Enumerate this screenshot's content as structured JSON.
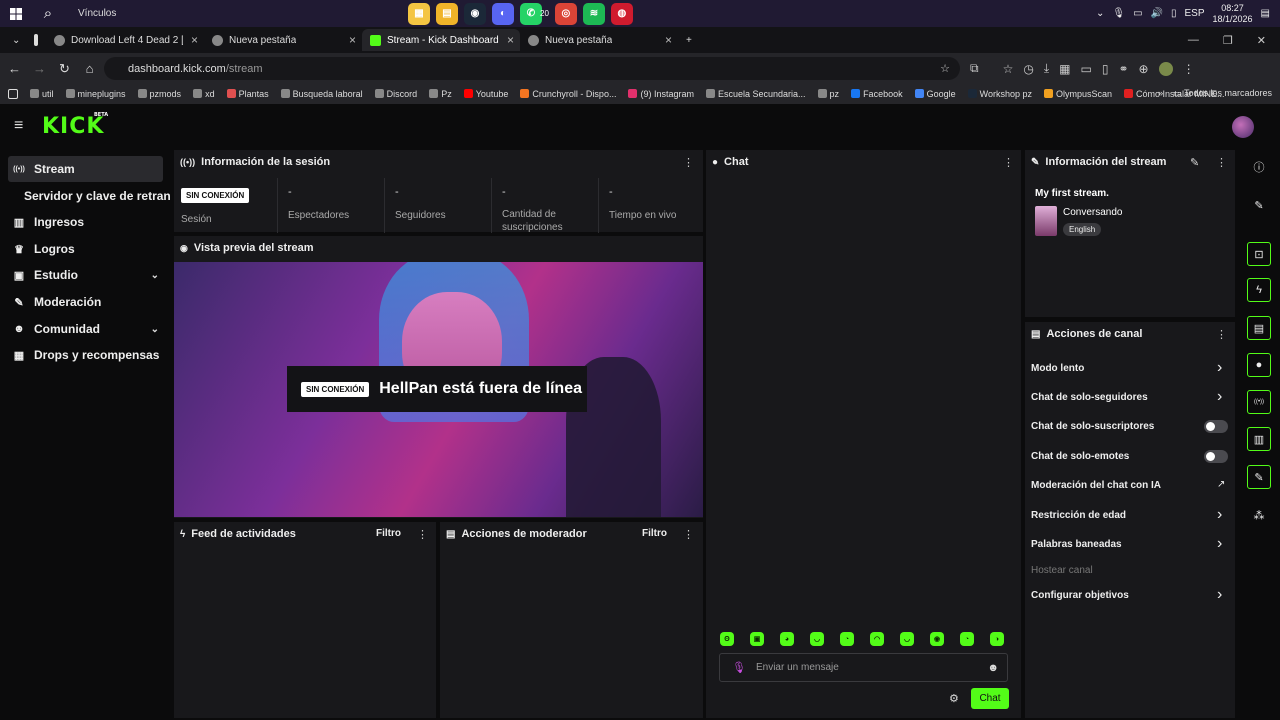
{
  "taskbar": {
    "vinculos": "Vínculos",
    "apps": [
      {
        "name": "files-app",
        "glyph": "▦",
        "color": "#f4c542"
      },
      {
        "name": "explorer-app",
        "glyph": "▤",
        "color": "#f0b429"
      },
      {
        "name": "steam-app",
        "glyph": "◉",
        "color": "#1b2838"
      },
      {
        "name": "discord-app",
        "glyph": "◐",
        "color": "#5865f2"
      },
      {
        "name": "whatsapp-app",
        "glyph": "✆",
        "color": "#25d366"
      },
      {
        "name": "chrome-app",
        "glyph": "◎",
        "color": "#db4437"
      },
      {
        "name": "spotify-app",
        "glyph": "≋",
        "color": "#1db954"
      },
      {
        "name": "opera-app",
        "glyph": "◍",
        "color": "#d01b2e"
      }
    ],
    "whatsapp_badge": "20",
    "lang": "ESP",
    "time": "08:27",
    "date": "18/1/2026"
  },
  "browser": {
    "tabs": [
      {
        "title": "Download Left 4 Dead 2 [PC] [",
        "active": false
      },
      {
        "title": "Nueva pestaña",
        "active": false
      },
      {
        "title": "Stream - Kick Dashboard",
        "active": true
      },
      {
        "title": "Nueva pestaña",
        "active": false
      }
    ],
    "url_host": "dashboard.kick.com",
    "url_path": "/stream",
    "bookmarks": [
      {
        "label": "util",
        "color": "#888"
      },
      {
        "label": "mineplugins",
        "color": "#888"
      },
      {
        "label": "pzmods",
        "color": "#888"
      },
      {
        "label": "xd",
        "color": "#888"
      },
      {
        "label": "Plantas",
        "color": "#e05050"
      },
      {
        "label": "Busqueda laboral",
        "color": "#888"
      },
      {
        "label": "Discord",
        "color": "#888"
      },
      {
        "label": "Pz",
        "color": "#888"
      },
      {
        "label": "Youtube",
        "color": "#ff0000"
      },
      {
        "label": "Crunchyroll - Dispo...",
        "color": "#f47521"
      },
      {
        "label": "(9) Instagram",
        "color": "#e1306c"
      },
      {
        "label": "Escuela Secundaria...",
        "color": "#888"
      },
      {
        "label": "pz",
        "color": "#888"
      },
      {
        "label": "Facebook",
        "color": "#1877f2"
      },
      {
        "label": "Google",
        "color": "#4285f4"
      },
      {
        "label": "Workshop pz",
        "color": "#1b2838"
      },
      {
        "label": "OlympusScan",
        "color": "#f0a020"
      },
      {
        "label": "Cómo Instalar MINE...",
        "color": "#e02020"
      }
    ],
    "all_bookmarks": "Todos los marcadores"
  },
  "kick": {
    "logo": "KICK",
    "beta": "BETA"
  },
  "sidebar": {
    "items": [
      {
        "label": "Stream",
        "icon": "((•))",
        "active": true,
        "chevron": false,
        "sub": false
      },
      {
        "label": "Servidor y clave de retransmisión",
        "icon": "",
        "active": false,
        "chevron": false,
        "sub": true
      },
      {
        "label": "Ingresos",
        "icon": "▥",
        "active": false,
        "chevron": false,
        "sub": false
      },
      {
        "label": "Logros",
        "icon": "♛",
        "active": false,
        "chevron": false,
        "sub": false
      },
      {
        "label": "Estudio",
        "icon": "▣",
        "active": false,
        "chevron": true,
        "sub": false
      },
      {
        "label": "Moderación",
        "icon": "✎",
        "active": false,
        "chevron": false,
        "sub": false
      },
      {
        "label": "Comunidad",
        "icon": "☻",
        "active": false,
        "chevron": true,
        "sub": false
      },
      {
        "label": "Drops y recompensas",
        "icon": "▦",
        "active": false,
        "chevron": false,
        "sub": false
      }
    ]
  },
  "session": {
    "title": "Información de la sesión",
    "status_badge": "SIN CONEXIÓN",
    "stats": [
      {
        "value": "-",
        "label": "Espectadores"
      },
      {
        "value": "-",
        "label": "Seguidores"
      },
      {
        "value": "-",
        "label": "Cantidad de suscripciones"
      },
      {
        "value": "-",
        "label": "Tiempo en vivo"
      }
    ],
    "session_label": "Sesión"
  },
  "preview": {
    "title": "Vista previa del stream",
    "offline_badge": "SIN CONEXIÓN",
    "offline_text": "HellPan está fuera de línea"
  },
  "feed": {
    "title": "Feed de actividades",
    "filter": "Filtro"
  },
  "modactions": {
    "title": "Acciones de moderador",
    "filter": "Filtro"
  },
  "chat": {
    "title": "Chat",
    "placeholder": "Enviar un mensaje",
    "send": "Chat",
    "emotes": [
      "ʘ",
      "▣",
      "◕",
      "◡",
      "◔",
      "◠",
      "◡",
      "◉",
      "◔",
      "◑"
    ]
  },
  "stream_info": {
    "title": "Información del stream",
    "stream_title": "My first stream.",
    "category": "Conversando",
    "language": "English"
  },
  "channel_actions": {
    "title": "Acciones de canal",
    "items": [
      {
        "label": "Modo lento",
        "control": "chevron"
      },
      {
        "label": "Chat de solo-seguidores",
        "control": "chevron"
      },
      {
        "label": "Chat de solo-suscriptores",
        "control": "toggle"
      },
      {
        "label": "Chat de solo-emotes",
        "control": "toggle"
      },
      {
        "label": "Moderación del chat con IA",
        "control": "external"
      },
      {
        "label": "Restricción de edad",
        "control": "chevron"
      },
      {
        "label": "Palabras baneadas",
        "control": "chevron"
      },
      {
        "label": "Hostear canal",
        "control": "none",
        "disabled": true
      },
      {
        "label": "Configurar objetivos",
        "control": "chevron"
      }
    ]
  },
  "rail": {
    "icons": [
      "info-icon",
      "pencil-icon",
      "focus-icon",
      "bolt-icon",
      "document-icon",
      "chat-bubble-icon",
      "broadcast-icon",
      "layout-icon",
      "wrench-icon",
      "nodes-icon"
    ]
  }
}
